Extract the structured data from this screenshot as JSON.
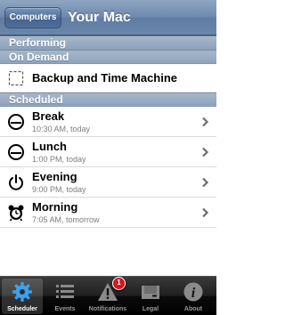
{
  "navbar": {
    "back_label": "Computers",
    "title": "Your Mac"
  },
  "status_header": "Performing",
  "on_demand": {
    "header": "On Demand",
    "items": [
      {
        "label": "Backup and Time Machine",
        "icon": "dashed-square-icon"
      }
    ]
  },
  "scheduled": {
    "header": "Scheduled",
    "items": [
      {
        "title": "Break",
        "subtitle": "10:30 AM, today",
        "icon": "sleep-icon"
      },
      {
        "title": "Lunch",
        "subtitle": "1:00 PM, today",
        "icon": "sleep-icon"
      },
      {
        "title": "Evening",
        "subtitle": "9:00 PM, today",
        "icon": "power-icon"
      },
      {
        "title": "Morning",
        "subtitle": "7:05 AM, tomorrow",
        "icon": "alarm-clock-icon"
      }
    ]
  },
  "tabs": [
    {
      "label": "Scheduler",
      "icon": "gear-icon",
      "selected": true
    },
    {
      "label": "Events",
      "icon": "list-icon",
      "selected": false
    },
    {
      "label": "Notifications",
      "icon": "warning-icon",
      "selected": false,
      "badge": "1"
    },
    {
      "label": "Legal",
      "icon": "inbox-icon",
      "selected": false
    },
    {
      "label": "About",
      "icon": "info-icon",
      "selected": false
    }
  ],
  "colors": {
    "navbar": "#6e89ad",
    "section_header": "#98abc1",
    "badge": "#d8141a",
    "tabbar": "#000000"
  }
}
